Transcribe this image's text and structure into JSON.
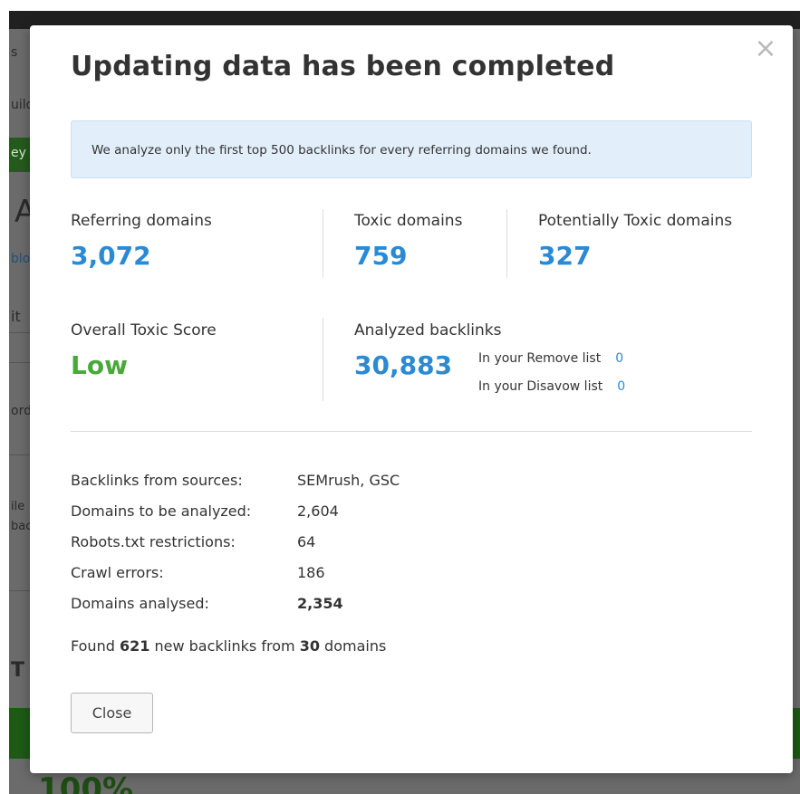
{
  "background": {
    "fragments": [
      "s",
      "uild",
      "ey",
      "A",
      "blo",
      "it",
      "ord",
      "ile",
      "bac",
      "T",
      "100%"
    ]
  },
  "modal": {
    "close_icon": "×",
    "title": "Updating data has been completed",
    "notice": "We analyze only the first top 500 backlinks for every referring domains we found.",
    "stats": {
      "referring": {
        "label": "Referring domains",
        "value": "3,072"
      },
      "toxic": {
        "label": "Toxic domains",
        "value": "759"
      },
      "potentially_toxic": {
        "label": "Potentially Toxic domains",
        "value": "327"
      },
      "score": {
        "label": "Overall Toxic Score",
        "value": "Low"
      },
      "analyzed": {
        "label": "Analyzed backlinks",
        "value": "30,883",
        "remove_label": "In your Remove list",
        "remove_count": "0",
        "disavow_label": "In your Disavow list",
        "disavow_count": "0"
      }
    },
    "details": [
      {
        "label": "Backlinks from sources:",
        "value": "SEMrush, GSC"
      },
      {
        "label": "Domains to be analyzed:",
        "value": "2,604"
      },
      {
        "label": "Robots.txt restrictions:",
        "value": "64"
      },
      {
        "label": "Crawl errors:",
        "value": "186"
      },
      {
        "label": "Domains analysed:",
        "value": "2,354"
      }
    ],
    "found": {
      "prefix": "Found",
      "new_count": "621",
      "middle": "new backlinks from",
      "domain_count": "30",
      "suffix": "domains"
    },
    "close_button": "Close"
  },
  "colors": {
    "accent_blue": "#2a8ad4",
    "score_green": "#49a83a",
    "notice_bg": "#e2effb"
  }
}
